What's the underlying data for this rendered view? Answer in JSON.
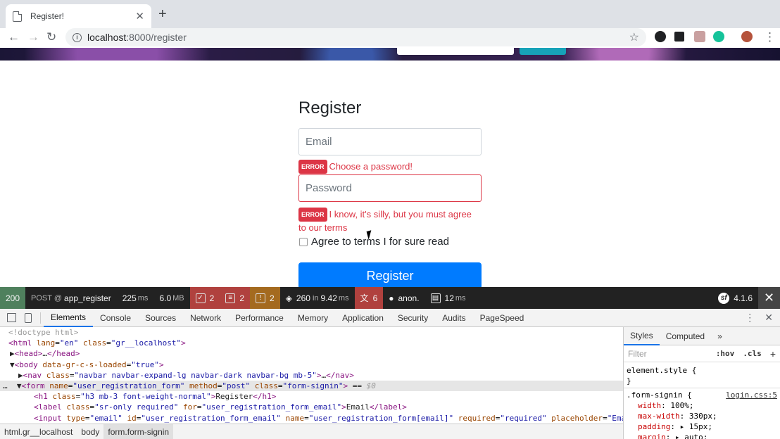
{
  "browser": {
    "tab_title": "Register!",
    "url_host": "localhost",
    "url_rest": ":8000/register"
  },
  "page": {
    "heading": "Register",
    "email_placeholder": "Email",
    "password_placeholder": "Password",
    "error_badge": "ERROR",
    "password_error": "Choose a password!",
    "terms_error": "I know, it's silly, but you must agree to our terms",
    "terms_label": "Agree to terms I for sure read",
    "submit_label": "Register"
  },
  "profiler": {
    "status": "200",
    "method": "POST @",
    "route": "app_register",
    "time": "225",
    "time_unit": "ms",
    "memory": "6.0",
    "memory_unit": "MB",
    "forms": "2",
    "logs": "2",
    "deprecations": "2",
    "cache_calls": "260",
    "cache_in": "in",
    "cache_time": "9.42",
    "cache_unit": "ms",
    "translation": "6",
    "user": "anon.",
    "twig_time": "12",
    "twig_unit": "ms",
    "version": "4.1.6",
    "colors": {
      "status": "#4f805d",
      "error": "#b0413e",
      "warning": "#a46a1f"
    }
  },
  "devtools": {
    "tabs": [
      "Elements",
      "Console",
      "Sources",
      "Network",
      "Performance",
      "Memory",
      "Application",
      "Security",
      "Audits",
      "PageSpeed"
    ],
    "active_tab": "Elements",
    "breadcrumbs": [
      "html.gr__localhost",
      "body",
      "form.form-signin"
    ],
    "styles_tabs": [
      "Styles",
      "Computed"
    ],
    "filter_placeholder": "Filter",
    "hov": ":hov",
    "cls": ".cls",
    "rules": {
      "element_style": "element.style {",
      "close": "}",
      "selector": ".form-signin {",
      "source": "login.css:5",
      "decls": [
        {
          "prop": "width",
          "val": "100%;"
        },
        {
          "prop": "max-width",
          "val": "330px;"
        },
        {
          "prop": "padding",
          "val": "▸ 15px;"
        },
        {
          "prop": "margin",
          "val": "▸ auto;"
        }
      ]
    }
  }
}
